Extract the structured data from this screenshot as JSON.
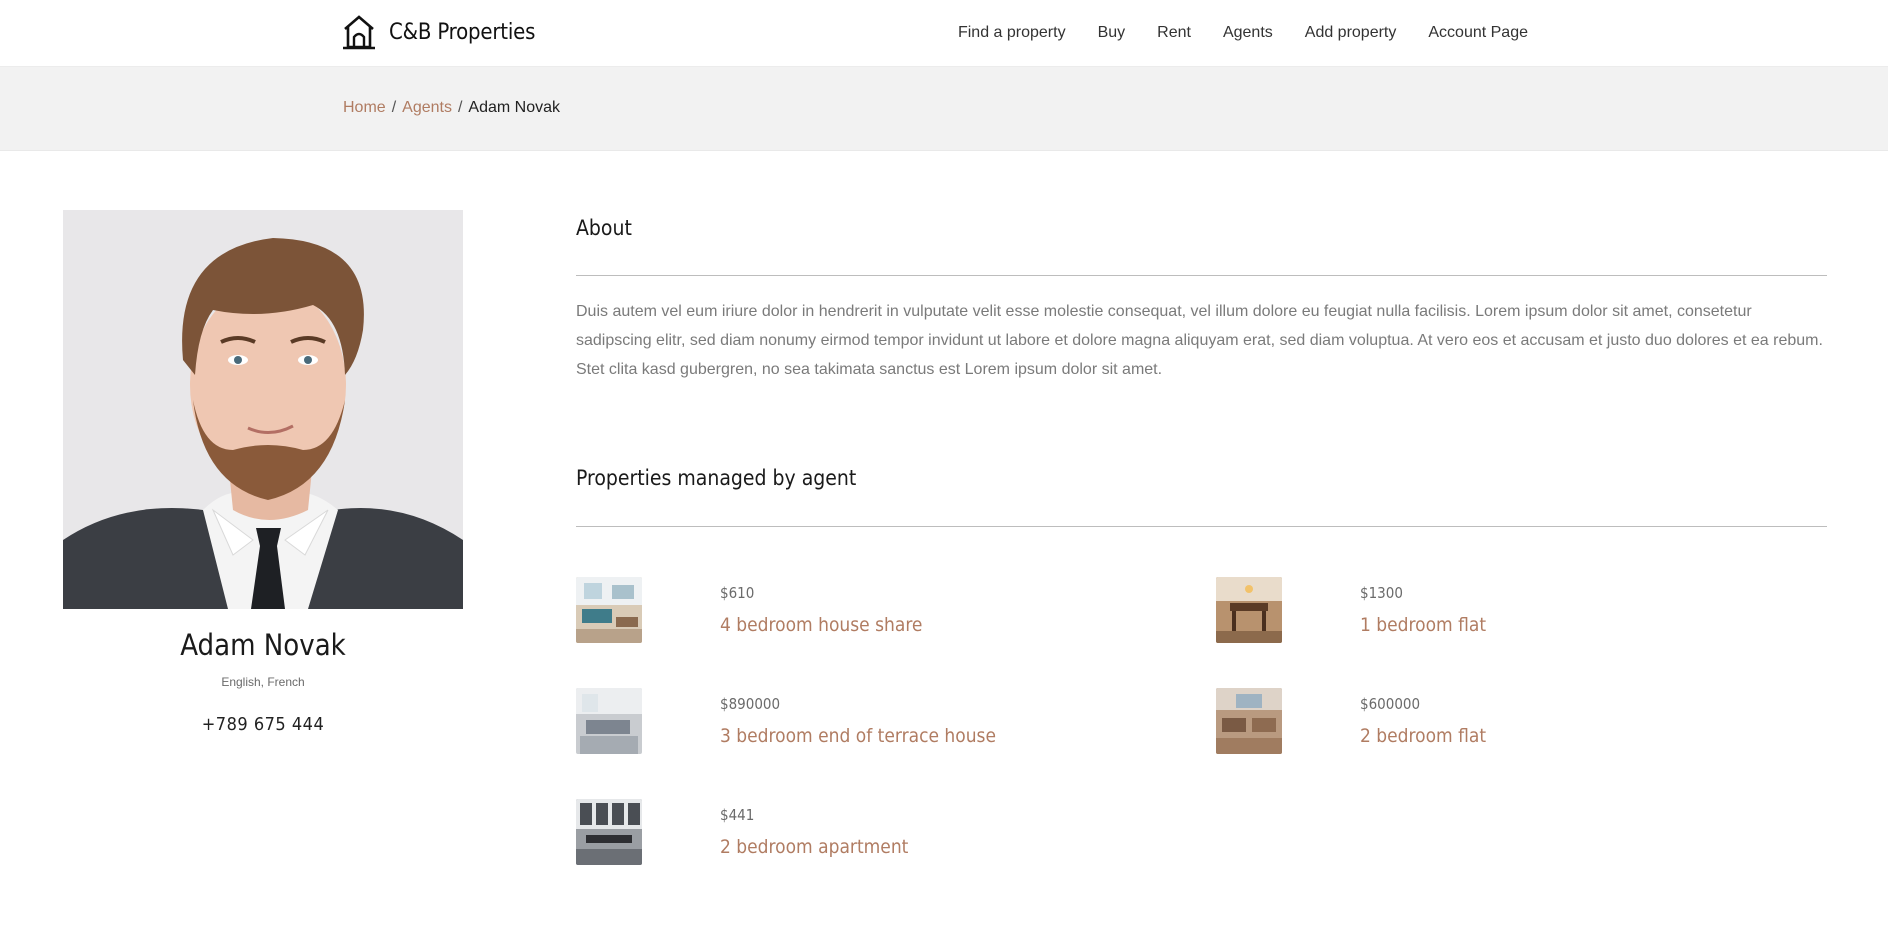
{
  "brand": {
    "name": "C&B Properties",
    "logo_icon": "house-icon"
  },
  "nav": {
    "items": [
      "Find a property",
      "Buy",
      "Rent",
      "Agents",
      "Add property",
      "Account Page"
    ]
  },
  "breadcrumb": {
    "items": [
      "Home",
      "Agents"
    ],
    "separator": "/",
    "current": "Adam Novak"
  },
  "agent": {
    "name": "Adam Novak",
    "languages": "English, French",
    "phone": "+789 675 444"
  },
  "about": {
    "title": "About",
    "text": "Duis autem vel eum iriure dolor in hendrerit in vulputate velit esse molestie consequat, vel illum dolore eu feugiat nulla facilisis. Lorem ipsum dolor sit amet, consetetur sadipscing elitr, sed diam nonumy eirmod tempor invidunt ut labore et dolore magna aliquyam erat, sed diam voluptua. At vero eos et accusam et justo duo dolores et ea rebum. Stet clita kasd gubergren, no sea takimata sanctus est Lorem ipsum dolor sit amet."
  },
  "properties": {
    "title": "Properties managed by agent",
    "items": [
      {
        "price": "$610",
        "title": "4 bedroom house share"
      },
      {
        "price": "$1300",
        "title": "1 bedroom flat"
      },
      {
        "price": "$890000",
        "title": "3 bedroom end of terrace house"
      },
      {
        "price": "$600000",
        "title": "2 bedroom flat"
      },
      {
        "price": "$441",
        "title": "2 bedroom apartment"
      }
    ]
  },
  "colors": {
    "accent": "#b07c62",
    "band": "#f2f2f2",
    "text": "#222222",
    "muted": "#7a7a7a"
  }
}
